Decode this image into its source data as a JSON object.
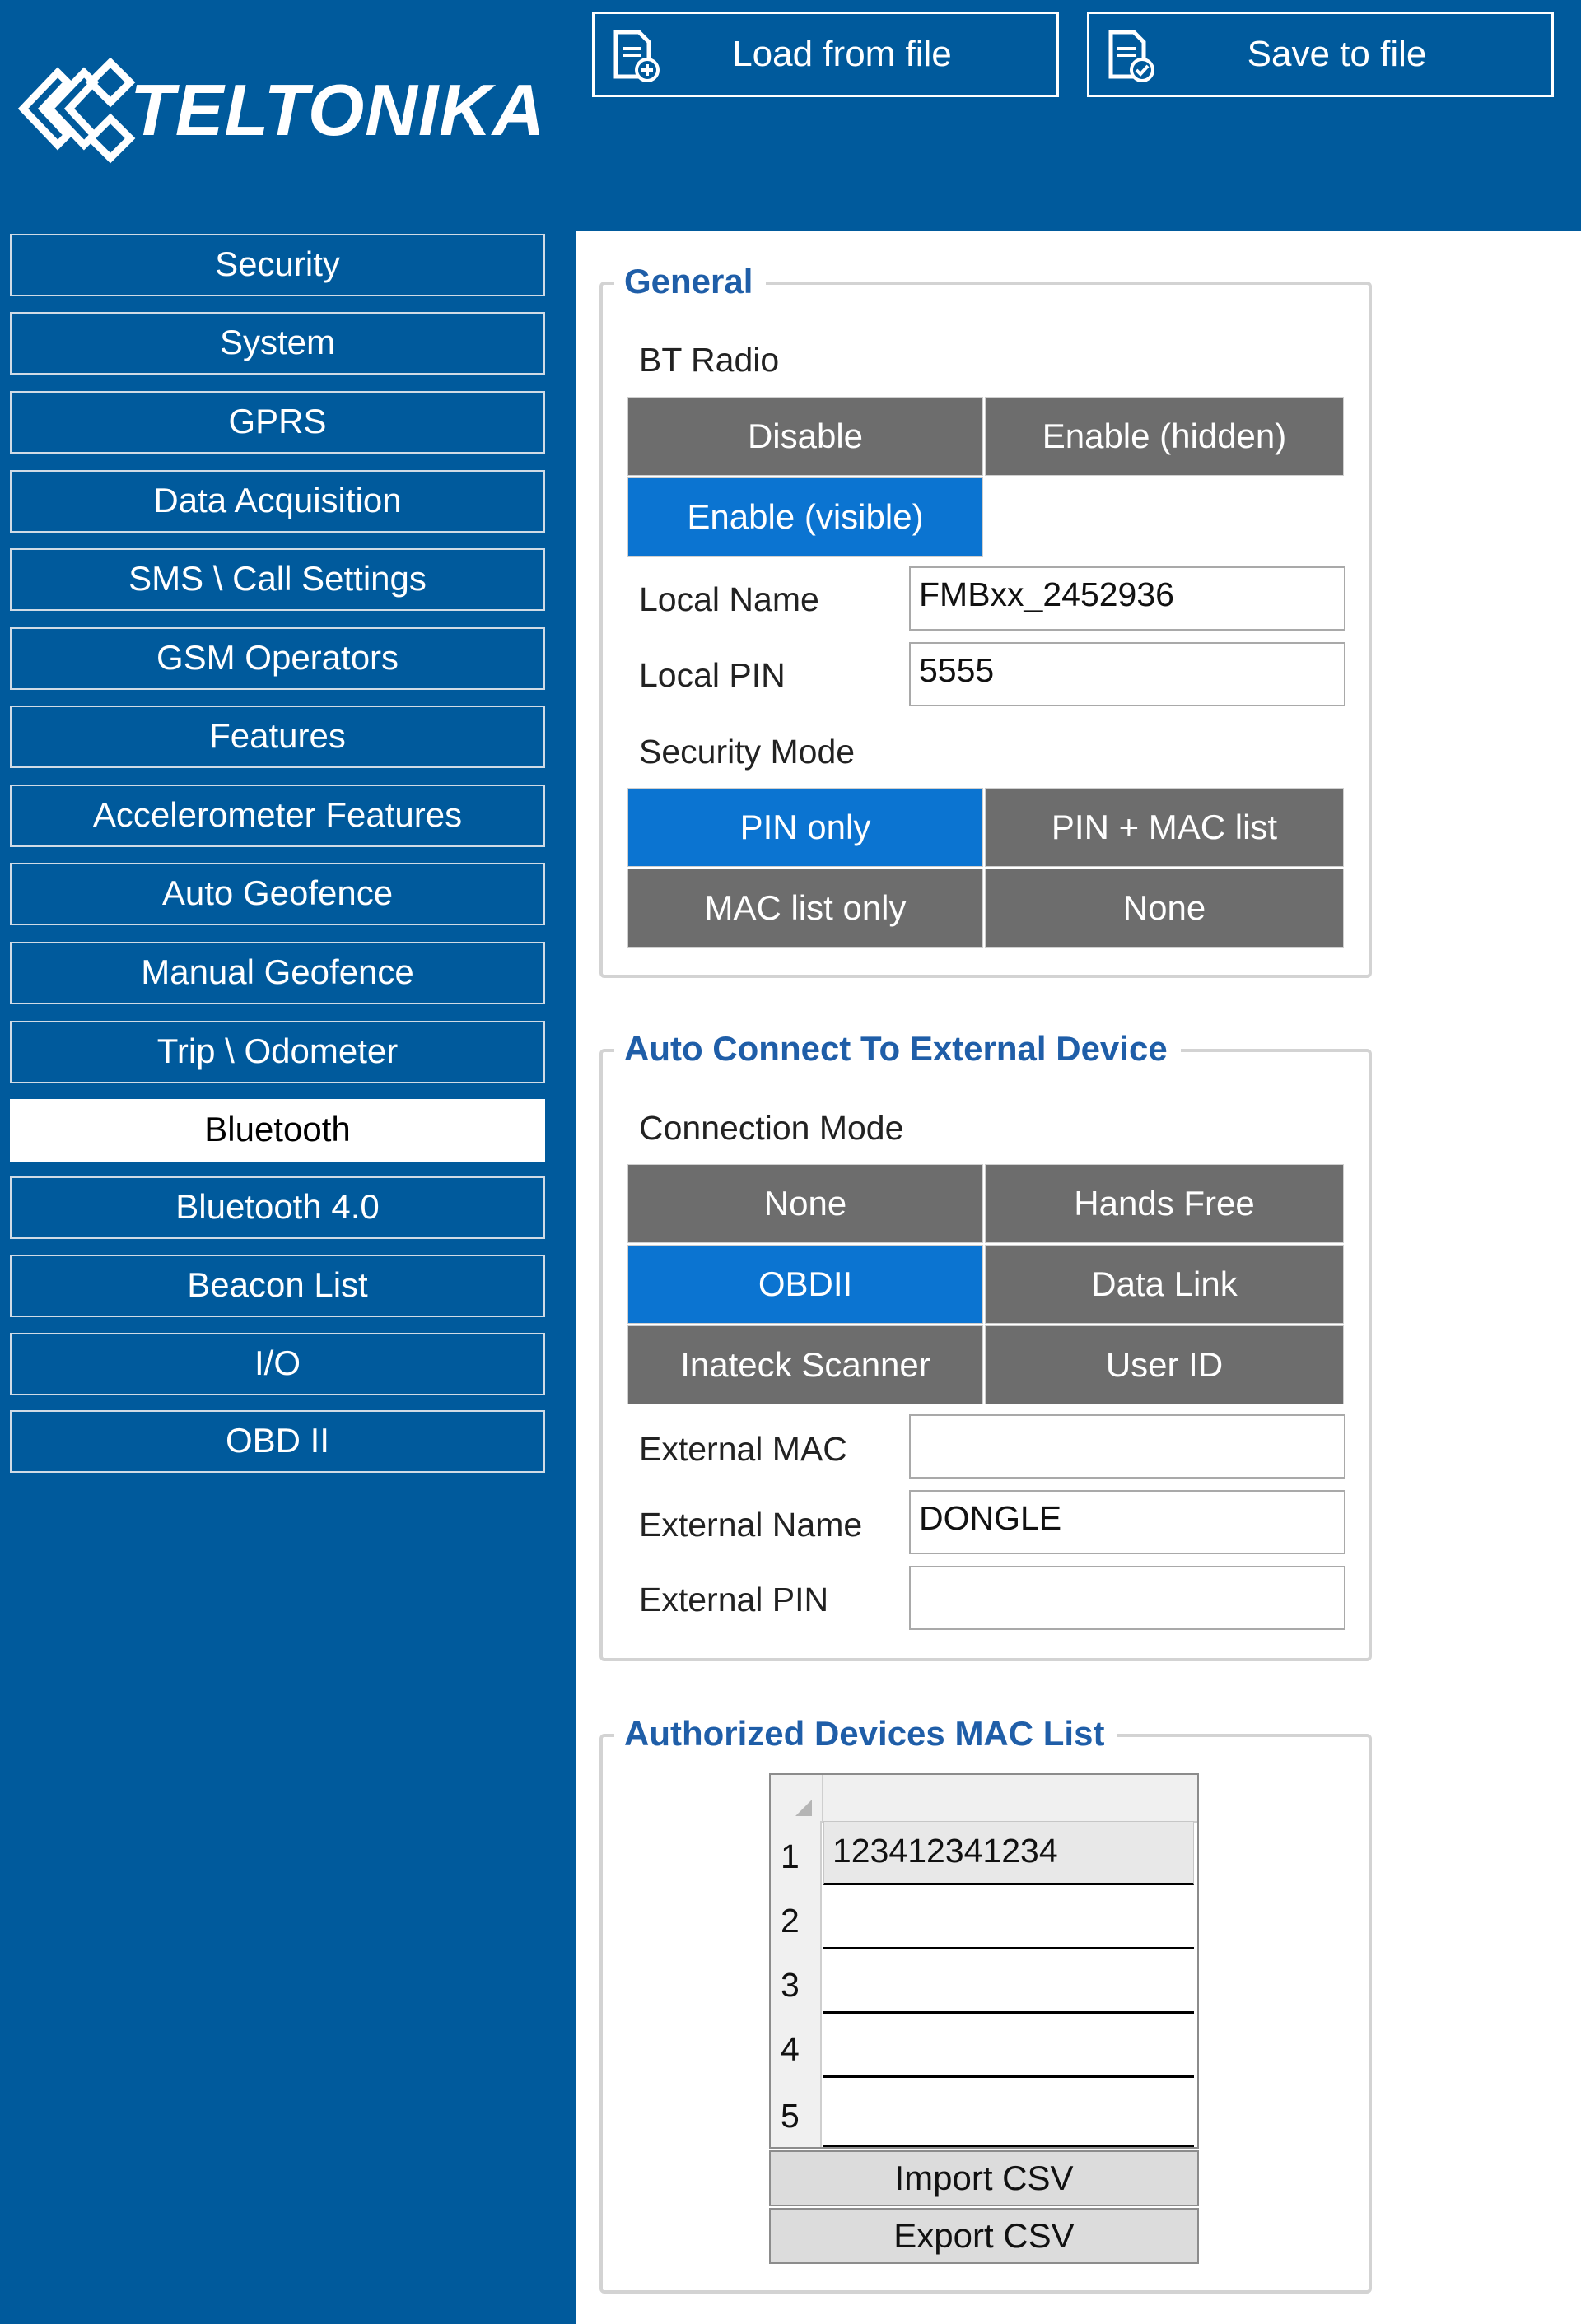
{
  "header": {
    "logo_text": "TELTONIKA",
    "load_label": "Load from file",
    "save_label": "Save to file"
  },
  "sidebar": {
    "items": [
      {
        "label": "Security"
      },
      {
        "label": "System"
      },
      {
        "label": "GPRS"
      },
      {
        "label": "Data Acquisition"
      },
      {
        "label": "SMS \\ Call Settings"
      },
      {
        "label": "GSM Operators"
      },
      {
        "label": "Features"
      },
      {
        "label": "Accelerometer Features"
      },
      {
        "label": "Auto Geofence"
      },
      {
        "label": "Manual Geofence"
      },
      {
        "label": "Trip \\ Odometer"
      },
      {
        "label": "Bluetooth",
        "active": true
      },
      {
        "label": "Bluetooth 4.0"
      },
      {
        "label": "Beacon List"
      },
      {
        "label": "I/O"
      },
      {
        "label": "OBD II"
      }
    ]
  },
  "general": {
    "title": "General",
    "bt_radio_label": "BT Radio",
    "bt_radio_options": [
      "Disable",
      "Enable (hidden)",
      "Enable (visible)"
    ],
    "bt_radio_selected": "Enable (visible)",
    "local_name_label": "Local Name",
    "local_name_value": "FMBxx_2452936",
    "local_pin_label": "Local PIN",
    "local_pin_value": "5555",
    "security_mode_label": "Security Mode",
    "security_mode_options": [
      "PIN only",
      "PIN + MAC list",
      "MAC list only",
      "None"
    ],
    "security_mode_selected": "PIN only"
  },
  "auto_connect": {
    "title": "Auto Connect To External Device",
    "connection_mode_label": "Connection Mode",
    "connection_mode_options": [
      "None",
      "Hands Free",
      "OBDII",
      "Data Link",
      "Inateck Scanner",
      "User ID"
    ],
    "connection_mode_selected": "OBDII",
    "external_mac_label": "External MAC",
    "external_mac_value": "",
    "external_name_label": "External Name",
    "external_name_value": "DONGLE",
    "external_pin_label": "External PIN",
    "external_pin_value": ""
  },
  "mac_list": {
    "title": "Authorized Devices MAC List",
    "rows": [
      {
        "num": "1",
        "value": "123412341234"
      },
      {
        "num": "2",
        "value": ""
      },
      {
        "num": "3",
        "value": ""
      },
      {
        "num": "4",
        "value": ""
      },
      {
        "num": "5",
        "value": ""
      }
    ],
    "import_label": "Import CSV",
    "export_label": "Export CSV"
  },
  "colors": {
    "brand_blue": "#005a9c",
    "selected_blue": "#0b74d1",
    "unselected_gray": "#6d6d6d",
    "group_title": "#1f5ea8"
  }
}
